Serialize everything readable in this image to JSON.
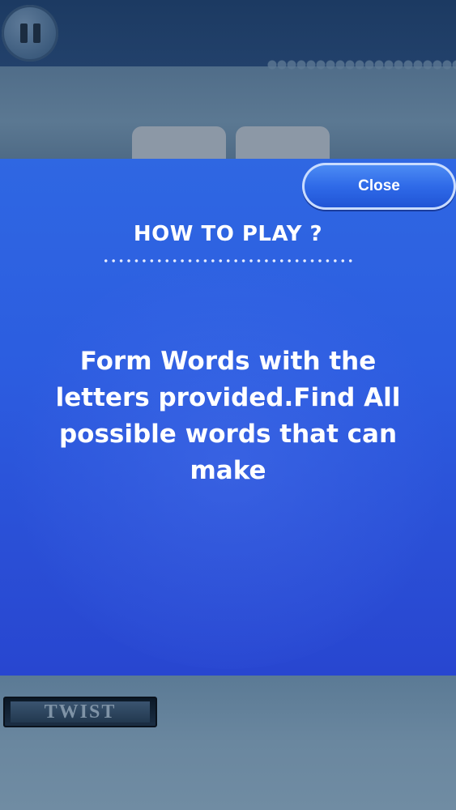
{
  "game": {
    "pause_icon": "pause-icon"
  },
  "modal": {
    "close_label": "Close",
    "title": "HOW TO PLAY ?",
    "instructions": "Form Words with the letters provided.Find All possible words that can make"
  },
  "bottom": {
    "twist_label": "TWIST"
  },
  "colors": {
    "modal_blue": "#2c5de0",
    "close_button": "#2f6ae8",
    "top_bar": "#1c3a62",
    "background": "#4c6a86"
  }
}
